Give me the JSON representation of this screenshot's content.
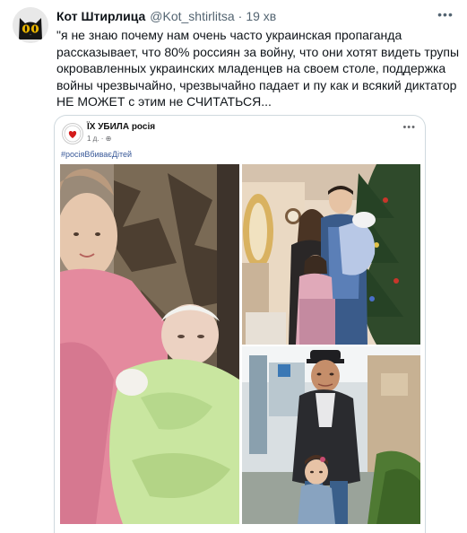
{
  "tweet": {
    "author_name": "Кот Штирлица",
    "author_handle": "@Kot_shtirlitsa",
    "separator": "·",
    "time": "19 хв",
    "text": "\"я не знаю почему нам очень часто украинская пропаганда рассказывает, что 80% россиян за войну, что они хотят видеть трупы окровавленных украинских младенцев на своем столе, поддержка войны чрезвычайно, чрезвычайно падает и пу как и всякий диктатор НЕ МОЖЕТ с этим не СЧИТАТЬСЯ...",
    "more_icon": "more-dots-icon"
  },
  "embed": {
    "page_name": "ЇХ УБИЛА росія",
    "meta": "1 д. · ⊕",
    "hashtag": "#росіяВбиваєДітей",
    "more_icon": "more-dots-icon"
  },
  "colors": {
    "text": "#0f1419",
    "secondary": "#536471",
    "link": "#385898",
    "border": "#cfd9de"
  }
}
